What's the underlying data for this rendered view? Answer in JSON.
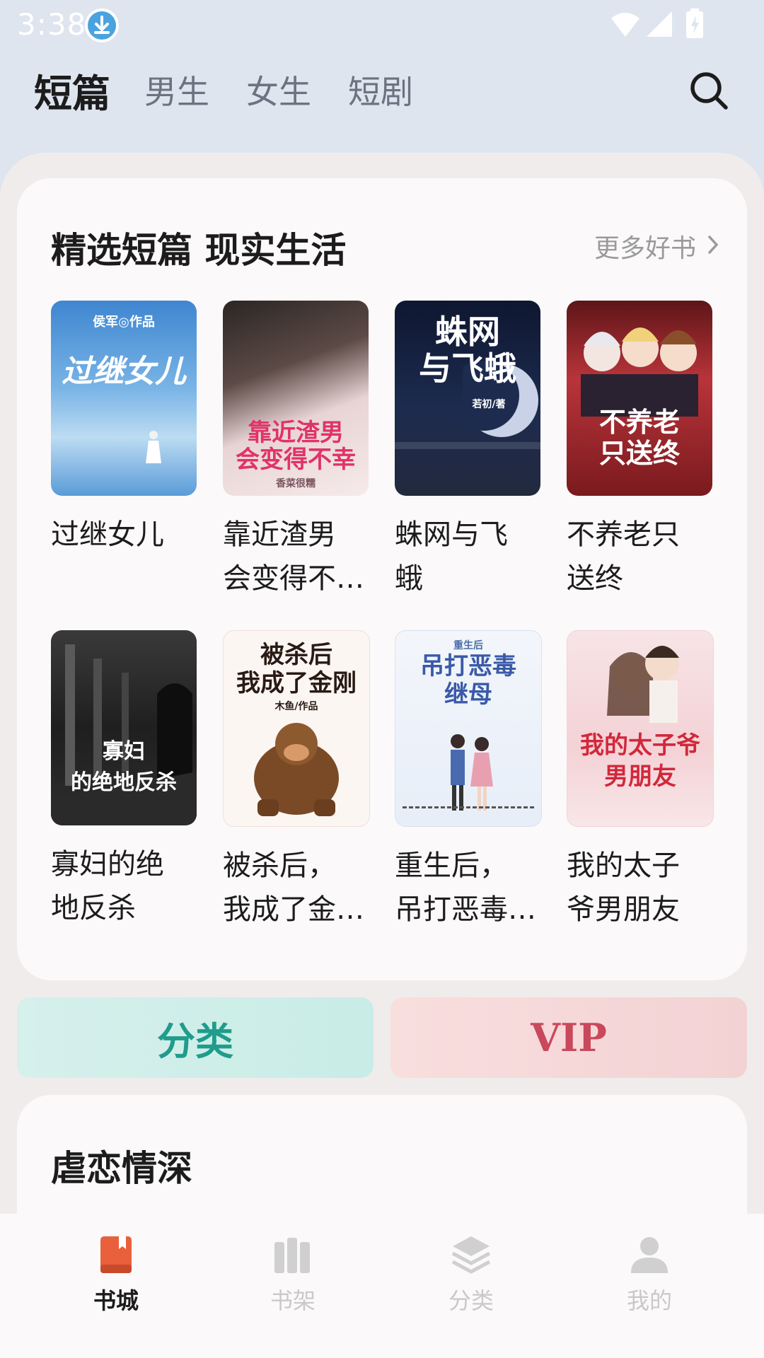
{
  "status": {
    "time": "3:38"
  },
  "top_tabs": [
    {
      "label": "短篇",
      "active": true
    },
    {
      "label": "男生"
    },
    {
      "label": "女生"
    },
    {
      "label": "短剧"
    }
  ],
  "section1": {
    "title": "精选短篇 现实生活",
    "more": "更多好书",
    "books": [
      {
        "title": "过继女儿",
        "cover_text": "过继女儿",
        "cover_sub": "侯军◎作品"
      },
      {
        "title": "靠近渣男\n会变得不…",
        "cover_text": "靠近渣男\n会变得不幸",
        "cover_sub": "香菜很糯"
      },
      {
        "title": " 蛛网与飞\n蛾",
        "cover_text": "蛛网\n与飞蛾",
        "cover_sub": "若初/著"
      },
      {
        "title": "不养老只\n送终",
        "cover_text": "不养老\n只送终",
        "cover_sub": ""
      },
      {
        "title": "寡妇的绝\n地反杀",
        "cover_text": "寡妇\n的绝地反杀",
        "cover_sub": ""
      },
      {
        "title": "被杀后，\n我成了金…",
        "cover_text": "被杀后\n我成了金刚",
        "cover_sub": "木鱼/作品"
      },
      {
        "title": "重生后，\n吊打恶毒…",
        "cover_text": "吊打恶毒\n继母",
        "cover_sub": "重生后"
      },
      {
        "title": "我的太子\n爷男朋友",
        "cover_text": "我的太子爷\n男朋友",
        "cover_sub": ""
      }
    ]
  },
  "buttons": {
    "category": "分类",
    "vip": "VIP"
  },
  "section2": {
    "title": "虐恋情深"
  },
  "bottom_nav": [
    {
      "label": "书城",
      "active": true
    },
    {
      "label": "书架"
    },
    {
      "label": "分类"
    },
    {
      "label": "我的"
    }
  ],
  "colors": {
    "accent": "#e8613c",
    "category_text": "#1f9c8c",
    "vip_text": "#c9485b"
  }
}
